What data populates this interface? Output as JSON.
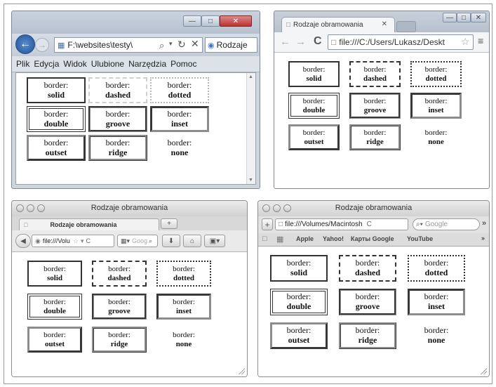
{
  "cells": [
    {
      "l1": "border:",
      "l2": "solid",
      "style": "solid"
    },
    {
      "l1": "border:",
      "l2": "dashed",
      "style": "dashed"
    },
    {
      "l1": "border:",
      "l2": "dotted",
      "style": "dotted"
    },
    {
      "l1": "border:",
      "l2": "double",
      "style": "double"
    },
    {
      "l1": "border:",
      "l2": "groove",
      "style": "groove"
    },
    {
      "l1": "border:",
      "l2": "inset",
      "style": "inset"
    },
    {
      "l1": "border:",
      "l2": "outset",
      "style": "outset"
    },
    {
      "l1": "border:",
      "l2": "ridge",
      "style": "ridge"
    },
    {
      "l1": "border:",
      "l2": "none",
      "style": "none"
    }
  ],
  "ie": {
    "address": "F:\\websites\\testy\\",
    "tab_title": "Rodzaje",
    "menu": [
      "Plik",
      "Edycja",
      "Widok",
      "Ulubione",
      "Narzędzia",
      "Pomoc"
    ]
  },
  "chrome": {
    "tab_title": "Rodzaje obramowania",
    "address": "file:///C:/Users/Lukasz/Deskt"
  },
  "firefox": {
    "window_title": "Rodzaje obramowania",
    "tab_title": "Rodzaje obramowania",
    "address": "file:///Volu",
    "search_placeholder": "Goog"
  },
  "safari": {
    "window_title": "Rodzaje obramowania",
    "address": "file:///Volumes/Macintosh",
    "search_placeholder": "Google",
    "bookmarks": [
      "Apple",
      "Yahoo!",
      "Карты Google",
      "YouTube"
    ]
  },
  "colors": {
    "border_dark": "#333333",
    "border_light": "#a0a0a0"
  }
}
